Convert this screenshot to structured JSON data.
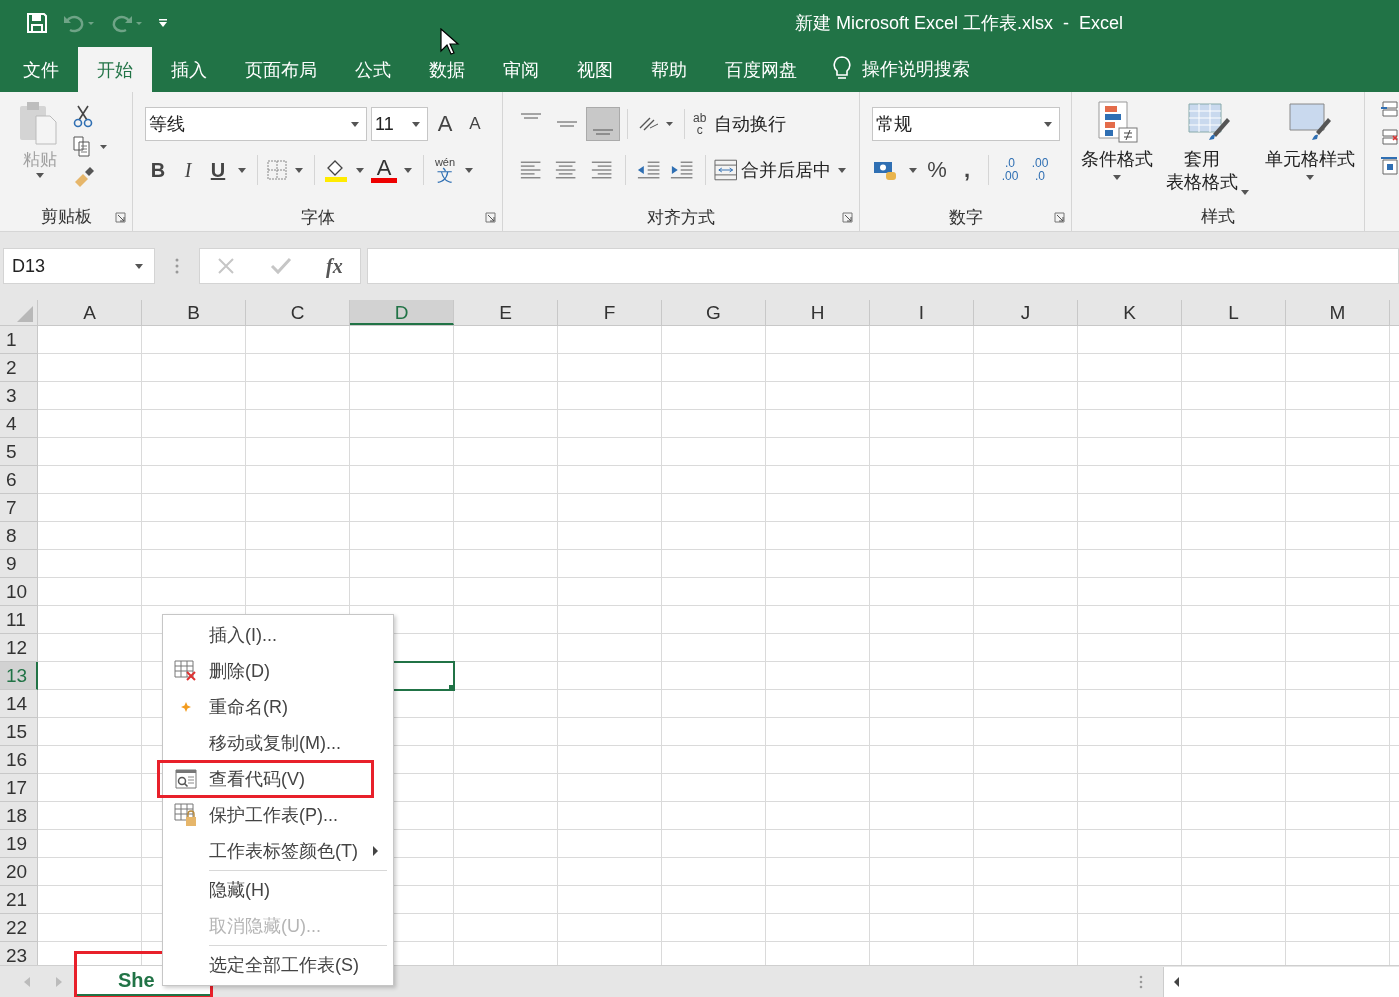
{
  "window": {
    "title": "新建 Microsoft Excel 工作表.xlsx  -  Excel"
  },
  "quick_access": [
    {
      "kind": "save",
      "disabled": false
    },
    {
      "kind": "undo",
      "disabled": true
    },
    {
      "kind": "redo",
      "disabled": true
    },
    {
      "kind": "customize",
      "disabled": false
    }
  ],
  "ribbon_tabs": [
    {
      "label": "文件",
      "selected": false
    },
    {
      "label": "开始",
      "selected": true
    },
    {
      "label": "插入",
      "selected": false
    },
    {
      "label": "页面布局",
      "selected": false
    },
    {
      "label": "公式",
      "selected": false
    },
    {
      "label": "数据",
      "selected": false
    },
    {
      "label": "审阅",
      "selected": false
    },
    {
      "label": "视图",
      "selected": false
    },
    {
      "label": "帮助",
      "selected": false
    },
    {
      "label": "百度网盘",
      "selected": false
    }
  ],
  "tell_me": {
    "label": "操作说明搜索"
  },
  "clipboard": {
    "paste": "粘贴",
    "label": "剪贴板"
  },
  "font": {
    "name": "等线",
    "size": "11",
    "grow": "A",
    "shrink": "A",
    "bold": "B",
    "italic": "I",
    "underline": "U",
    "color_letter": "A",
    "phonetic_top": "wén",
    "phonetic_bottom": "文",
    "label": "字体"
  },
  "alignment": {
    "wrap_icon_top": "ab",
    "wrap_icon_bottom": "c",
    "wrap_text": "自动换行",
    "merge_center": "合并后居中",
    "label": "对齐方式"
  },
  "number": {
    "format": "常规",
    "percent": "%",
    "comma": ",",
    "decimals": [
      {
        "top": ".0",
        "bottom": ".00"
      },
      {
        "top": ".00",
        "bottom": ".0"
      }
    ],
    "label": "数字"
  },
  "styles": {
    "buttons": [
      {
        "lines": [
          "条件格式"
        ]
      },
      {
        "lines": [
          "套用",
          "表格格式"
        ]
      },
      {
        "lines": [
          "单元格样式"
        ]
      }
    ],
    "label": "样式"
  },
  "formula_bar": {
    "name_box": "D13",
    "fx": "fx"
  },
  "columns": [
    {
      "label": "A",
      "selected": false
    },
    {
      "label": "B",
      "selected": false
    },
    {
      "label": "C",
      "selected": false
    },
    {
      "label": "D",
      "selected": true
    },
    {
      "label": "E",
      "selected": false
    },
    {
      "label": "F",
      "selected": false
    },
    {
      "label": "G",
      "selected": false
    },
    {
      "label": "H",
      "selected": false
    },
    {
      "label": "I",
      "selected": false
    },
    {
      "label": "J",
      "selected": false
    },
    {
      "label": "K",
      "selected": false
    },
    {
      "label": "L",
      "selected": false
    },
    {
      "label": "M",
      "selected": false
    }
  ],
  "rows": [
    {
      "label": "1",
      "selected": false
    },
    {
      "label": "2",
      "selected": false
    },
    {
      "label": "3",
      "selected": false
    },
    {
      "label": "4",
      "selected": false
    },
    {
      "label": "5",
      "selected": false
    },
    {
      "label": "6",
      "selected": false
    },
    {
      "label": "7",
      "selected": false
    },
    {
      "label": "8",
      "selected": false
    },
    {
      "label": "9",
      "selected": false
    },
    {
      "label": "10",
      "selected": false
    },
    {
      "label": "11",
      "selected": false
    },
    {
      "label": "12",
      "selected": false
    },
    {
      "label": "13",
      "selected": true
    },
    {
      "label": "14",
      "selected": false
    },
    {
      "label": "15",
      "selected": false
    },
    {
      "label": "16",
      "selected": false
    },
    {
      "label": "17",
      "selected": false
    },
    {
      "label": "18",
      "selected": false
    },
    {
      "label": "19",
      "selected": false
    },
    {
      "label": "20",
      "selected": false
    },
    {
      "label": "21",
      "selected": false
    },
    {
      "label": "22",
      "selected": false
    },
    {
      "label": "23",
      "selected": false
    }
  ],
  "context_menu": [
    {
      "label": "插入(I)...",
      "kind": "insert",
      "disabled": false,
      "submenu": false,
      "separator_before": false,
      "highlighted": false
    },
    {
      "label": "删除(D)",
      "kind": "delete",
      "disabled": false,
      "submenu": false,
      "separator_before": false,
      "highlighted": false
    },
    {
      "label": "重命名(R)",
      "kind": "rename",
      "disabled": false,
      "submenu": false,
      "separator_before": false,
      "highlighted": false
    },
    {
      "label": "移动或复制(M)...",
      "kind": "move",
      "disabled": false,
      "submenu": false,
      "separator_before": false,
      "highlighted": false
    },
    {
      "label": "查看代码(V)",
      "kind": "view_code",
      "disabled": false,
      "submenu": false,
      "separator_before": false,
      "highlighted": true
    },
    {
      "label": "保护工作表(P)...",
      "kind": "protect",
      "disabled": false,
      "submenu": false,
      "separator_before": false,
      "highlighted": false
    },
    {
      "label": "工作表标签颜色(T)",
      "kind": "tab_color",
      "disabled": false,
      "submenu": true,
      "separator_before": false,
      "highlighted": false
    },
    {
      "label": "隐藏(H)",
      "kind": "hide",
      "disabled": false,
      "submenu": false,
      "separator_before": true,
      "highlighted": false
    },
    {
      "label": "取消隐藏(U)...",
      "kind": "unhide",
      "disabled": true,
      "submenu": false,
      "separator_before": false,
      "highlighted": false
    },
    {
      "label": "选定全部工作表(S)",
      "kind": "select_all",
      "disabled": false,
      "submenu": false,
      "separator_before": true,
      "highlighted": false
    }
  ],
  "sheet_tabs": [
    {
      "label": "She",
      "selected": true,
      "highlighted": true
    }
  ]
}
